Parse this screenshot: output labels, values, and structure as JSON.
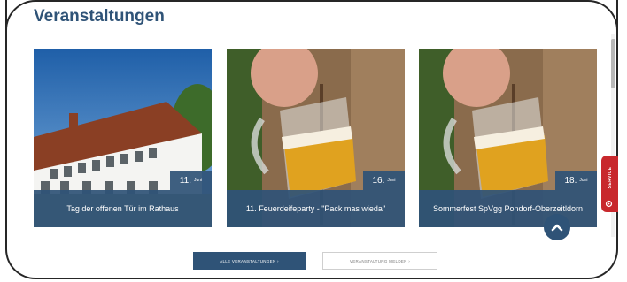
{
  "section": {
    "title": "Veranstaltungen"
  },
  "events": [
    {
      "title": "Tag der offenen Tür im Rathaus",
      "day": "11.",
      "month": "Juni"
    },
    {
      "title": "11. Feuerdeifeparty - \"Pack mas wieda\"",
      "day": "16.",
      "month": "Juni"
    },
    {
      "title": "Sommerfest SpVgg Pondorf-Oberzeitldorn",
      "day": "18.",
      "month": "Juni"
    }
  ],
  "buttons": {
    "all_events": "ALLE VERANSTALTUNGEN ›",
    "report_event": "VERANSTALTUNG MELDEN ›"
  },
  "service_tab": {
    "label": "SERVICE",
    "icon": "gear-icon"
  },
  "scroll_top": {
    "icon": "chevron-up-icon"
  },
  "colors": {
    "primary": "#2f5377",
    "service": "#c8282d"
  }
}
